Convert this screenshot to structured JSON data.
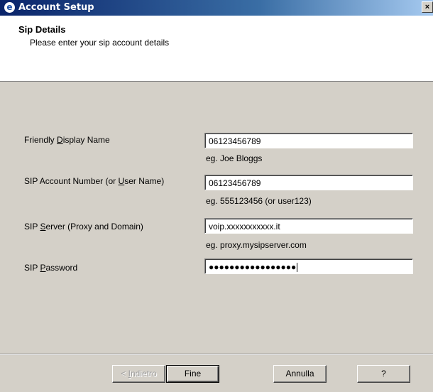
{
  "window": {
    "title": "Account Setup",
    "close_glyph": "×",
    "app_icon": "app-logo-icon"
  },
  "header": {
    "title": "Sip Details",
    "subtitle": "Please enter your sip account details"
  },
  "fields": {
    "display_name": {
      "label_pre": "Friendly ",
      "label_key": "D",
      "label_post": "isplay Name",
      "value": "06123456789",
      "hint": "eg.  Joe Bloggs"
    },
    "account_number": {
      "label_pre": "SIP Account Number (or ",
      "label_key": "U",
      "label_post": "ser Name)",
      "value": "06123456789",
      "hint": "eg.  555123456  (or user123)"
    },
    "server": {
      "label_pre": "SIP ",
      "label_key": "S",
      "label_post": "erver (Proxy and Domain)",
      "value": "voip.xxxxxxxxxxx.it",
      "hint": "eg. proxy.mysipserver.com"
    },
    "password": {
      "label_pre": "SIP ",
      "label_key": "P",
      "label_post": "assword",
      "value": "●●●●●●●●●●●●●●●●●"
    }
  },
  "buttons": {
    "back": {
      "key": "I",
      "pre": "< ",
      "post": "ndietro"
    },
    "finish": "Fine",
    "cancel": "Annulla",
    "help": "?"
  }
}
